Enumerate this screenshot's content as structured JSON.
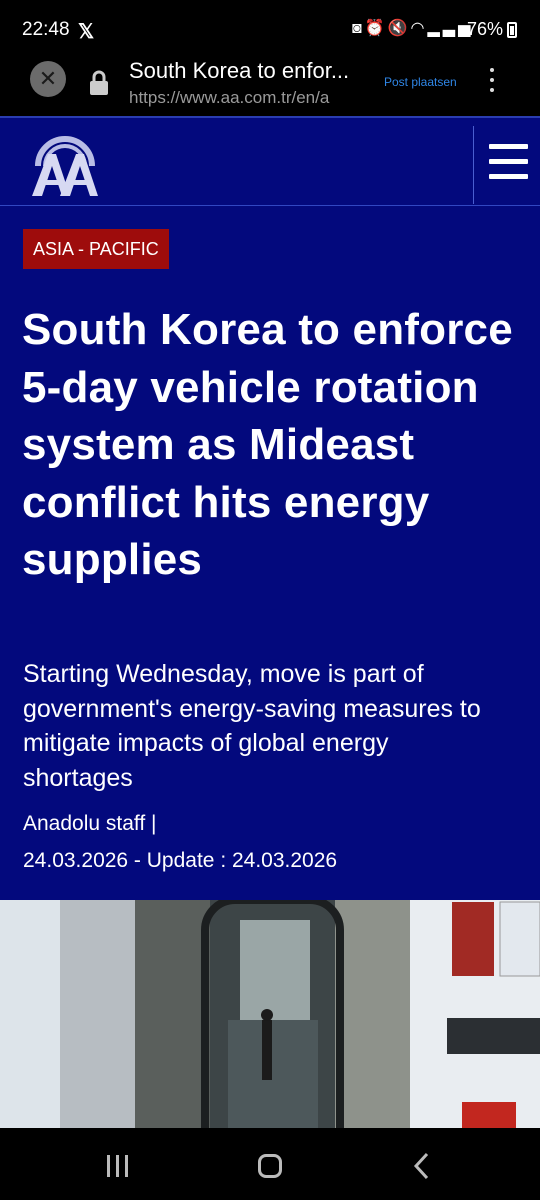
{
  "status": {
    "time": "22:48",
    "app_icon": "x-logo-icon",
    "icons": [
      "notification-icon",
      "alarm-icon",
      "mute-icon",
      "wifi-icon",
      "signal-icon"
    ],
    "battery": "76%"
  },
  "browser": {
    "title": "South Korea to enfor...",
    "url": "https://www.aa.com.tr/en/a",
    "post_link": "Post plaatsen",
    "menu_icon": "more-vert-icon"
  },
  "header": {
    "logo": "aa-logo-icon",
    "menu_icon": "hamburger-icon",
    "colors": {
      "background": "#03097d",
      "badge": "#9e0c0c"
    }
  },
  "article": {
    "category": "ASIA - PACIFIC",
    "headline": "South Korea to enforce 5-day vehicle rotation system as Mideast conflict hits energy supplies",
    "subtitle": "Starting Wednesday, move is part of government's energy-saving measures to mitigate impacts of global energy shortages",
    "author": "Anadolu staff  |",
    "date": "24.03.2026 - Update : 24.03.2026"
  },
  "navbar": {
    "icons": [
      "recents-icon",
      "home-icon",
      "back-icon"
    ]
  }
}
